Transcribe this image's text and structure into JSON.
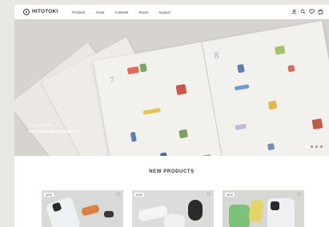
{
  "header": {
    "logo_text": "HITOTOKI",
    "nav": [
      "Products",
      "About",
      "Contents",
      "Stores",
      "Support"
    ],
    "icons": [
      "account-icon",
      "search-icon",
      "heart-icon",
      "bag-icon"
    ]
  },
  "hero": {
    "caption": "HITOTOKI NOTE MONTHLY",
    "sub": "HITOTOKI NOTE",
    "months": [
      "7",
      "8"
    ],
    "slides": 4,
    "active_slide": 0
  },
  "products": {
    "title": "NEW PRODUCTS",
    "cards": [
      {
        "badge": "NEW"
      },
      {
        "badge": "NEW"
      },
      {
        "badge": "NEW"
      }
    ]
  },
  "colors": {
    "header_bg": "#ffffff",
    "hero_bg": "#d7d4cf",
    "section_bg": "#ffffff"
  }
}
